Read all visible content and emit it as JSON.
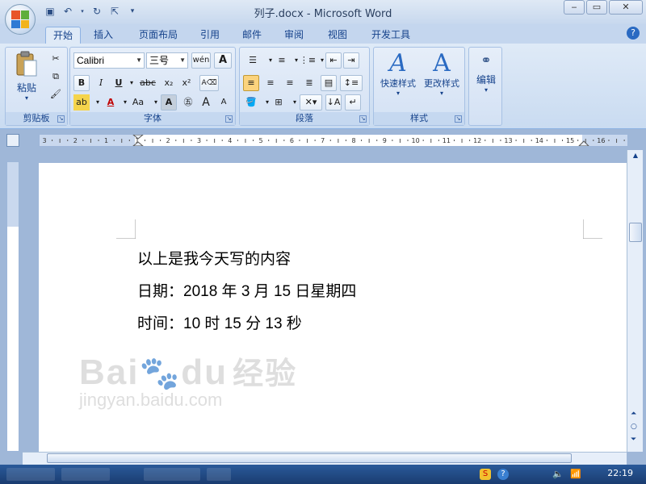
{
  "window": {
    "title": "列子.docx - Microsoft Word"
  },
  "tabs": [
    "开始",
    "插入",
    "页面布局",
    "引用",
    "邮件",
    "审阅",
    "视图",
    "开发工具"
  ],
  "ribbon": {
    "clipboard": {
      "paste_label": "粘贴",
      "group_label": "剪贴板"
    },
    "font": {
      "font_name": "Calibri",
      "font_size": "三号",
      "group_label": "字体",
      "phonetic": "wén",
      "bold": "B",
      "italic": "I",
      "underline": "U",
      "strike": "abc",
      "subscript": "x₂",
      "superscript": "x²",
      "case": "Aa",
      "box": "A",
      "grow": "A",
      "shrink": "A"
    },
    "paragraph": {
      "group_label": "段落"
    },
    "styles": {
      "quick_label": "快速样式",
      "change_label": "更改样式",
      "group_label": "样式"
    },
    "editing": {
      "label": "编辑"
    }
  },
  "ruler": {
    "numbers": [
      "3",
      "2",
      "1",
      "1",
      "2",
      "3",
      "4",
      "5",
      "6",
      "7",
      "8",
      "9",
      "10",
      "11",
      "12",
      "13",
      "14",
      "15",
      "16"
    ]
  },
  "document": {
    "lines": [
      "以上是我今天写的内容",
      "日期：2018 年 3 月 15 日星期四",
      "时间：10 时 15 分 13 秒"
    ]
  },
  "watermark": {
    "brand": "Bai",
    "brand2": "du",
    "cn": "经验",
    "url": "jingyan.baidu.com"
  },
  "taskbar": {
    "clock": "22:19"
  }
}
